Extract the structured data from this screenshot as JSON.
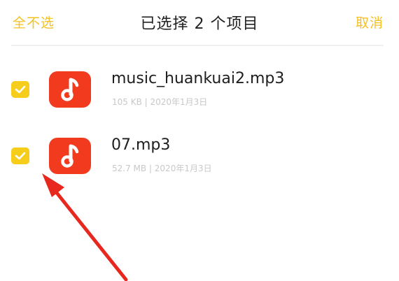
{
  "header": {
    "deselect_all_label": "全不选",
    "title": "已选择 2 个项目",
    "cancel_label": "取消"
  },
  "files": [
    {
      "name": "music_huankuai2.mp3",
      "meta": "105 KB | 2020年1月3日",
      "checked": true,
      "icon": "music-note-icon"
    },
    {
      "name": "07.mp3",
      "meta": "52.7 MB | 2020年1月3日",
      "checked": true,
      "icon": "music-note-icon"
    }
  ],
  "colors": {
    "accent": "#f5c021",
    "checkbox": "#f5cd1a",
    "file_icon_bg": "#f23a1f",
    "annotation_arrow": "#e8281e"
  },
  "annotation": {
    "type": "red-arrow",
    "points_to": "checkbox"
  }
}
